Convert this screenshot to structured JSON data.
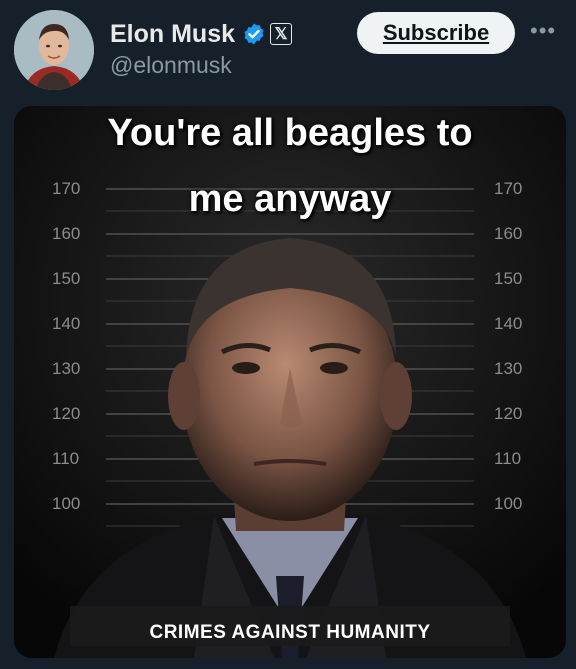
{
  "post": {
    "author_name": "Elon Musk",
    "author_handle": "@elonmusk",
    "verified_icon": "verified-badge-icon",
    "affiliation_icon": "x-logo-icon",
    "x_glyph": "𝕏",
    "subscribe_label": "Subscribe",
    "more_glyph": "•••"
  },
  "media": {
    "caption_line1": "You're all beagles to",
    "caption_line2": "me anyway",
    "bottom_banner": "CRIMES AGAINST HUMANITY",
    "height_ticks_left": [
      "170",
      "160",
      "150",
      "140",
      "130",
      "120",
      "110",
      "100"
    ],
    "height_ticks_right": [
      "170",
      "160",
      "150",
      "140",
      "130",
      "120",
      "110",
      "100"
    ]
  },
  "colors": {
    "background": "#15202b",
    "verified_blue": "#1d9bf0",
    "subscribe_bg": "#eff3f4"
  }
}
